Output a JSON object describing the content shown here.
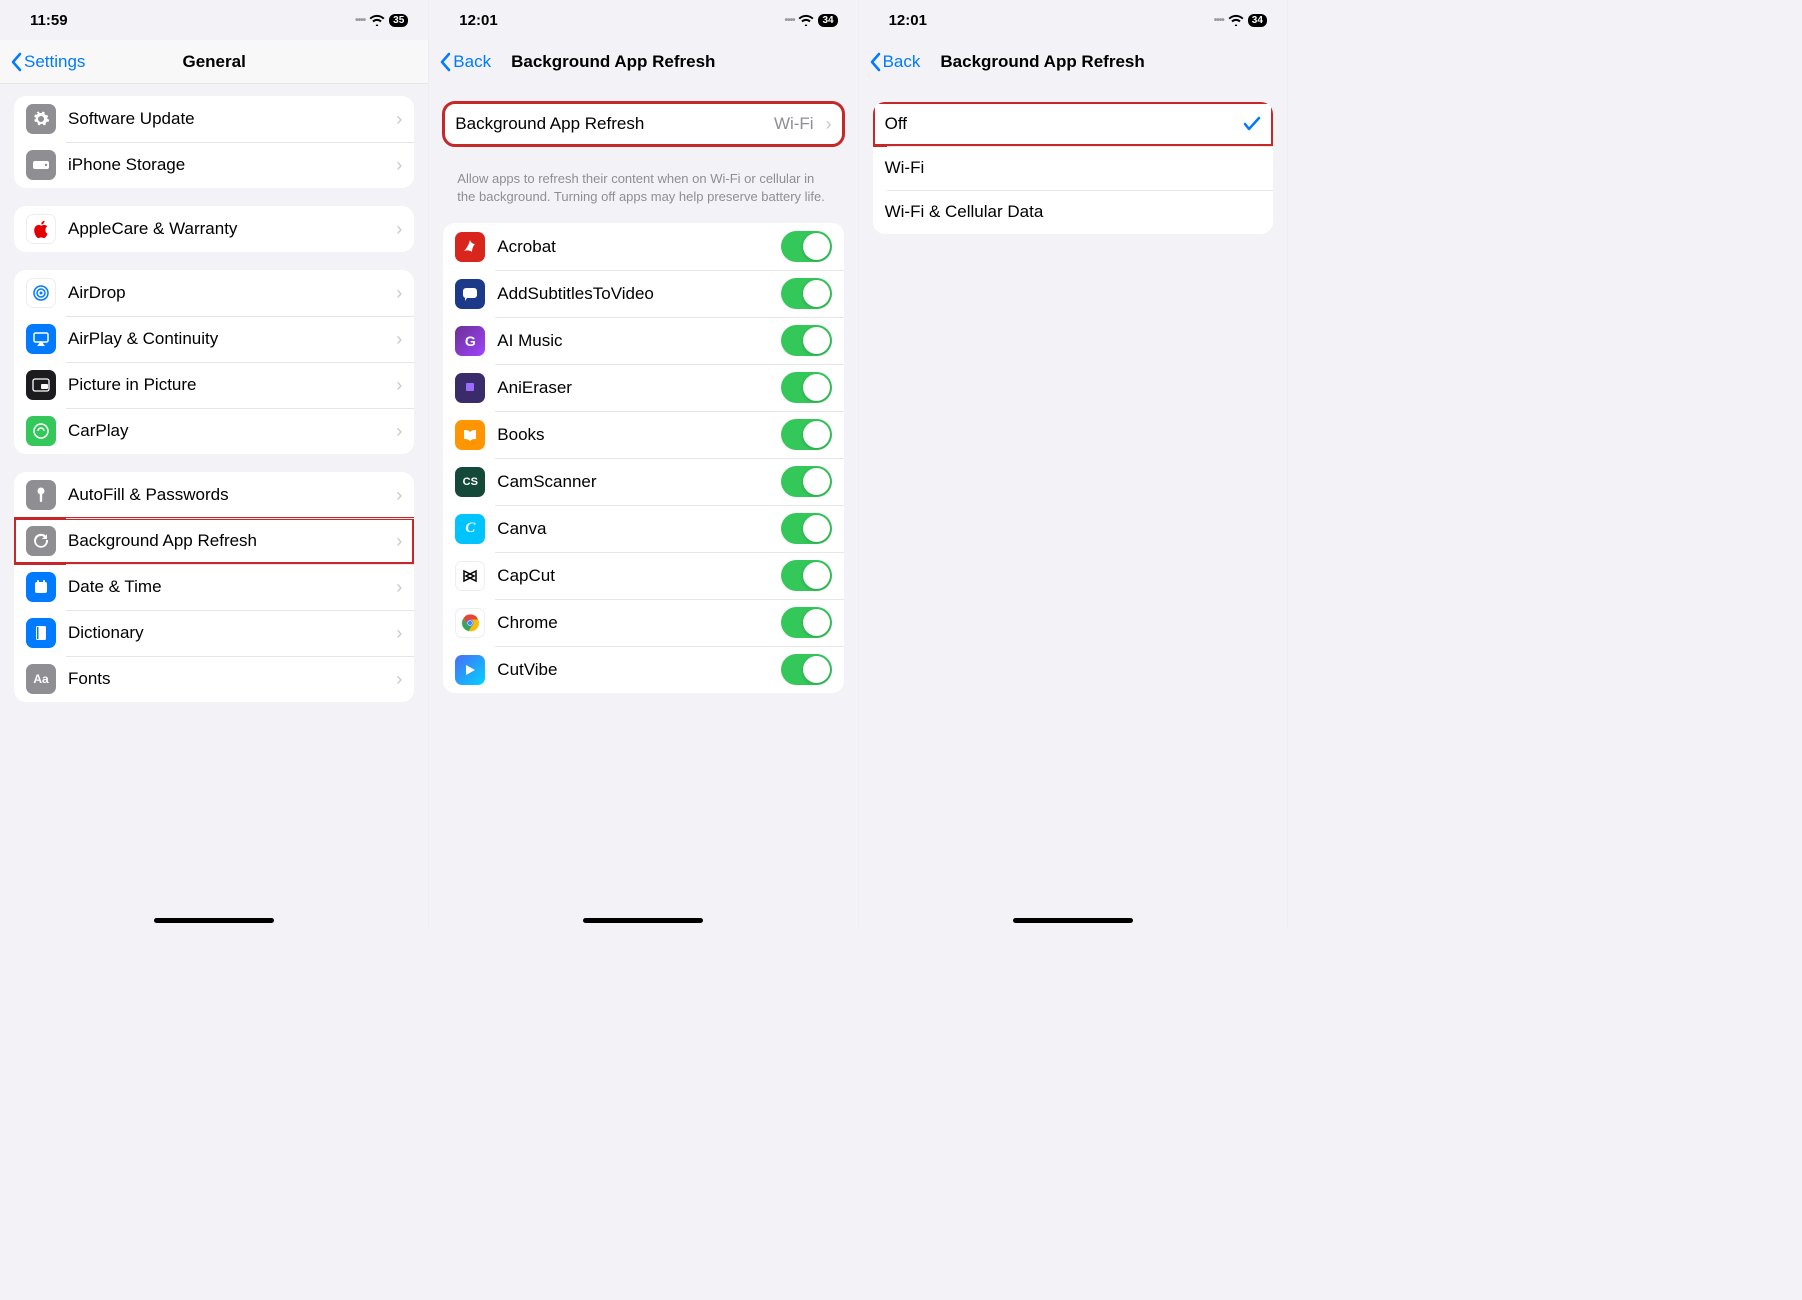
{
  "screen1": {
    "time": "11:59",
    "battery": "35",
    "back": "Settings",
    "title": "General",
    "groups": [
      {
        "rows": [
          {
            "icon": "gear-icon",
            "label": "Software Update"
          },
          {
            "icon": "storage-icon",
            "label": "iPhone Storage"
          }
        ]
      },
      {
        "rows": [
          {
            "icon": "apple-icon",
            "label": "AppleCare & Warranty"
          }
        ]
      },
      {
        "rows": [
          {
            "icon": "airdrop-icon",
            "label": "AirDrop"
          },
          {
            "icon": "airplay-icon",
            "label": "AirPlay & Continuity"
          },
          {
            "icon": "pip-icon",
            "label": "Picture in Picture"
          },
          {
            "icon": "carplay-icon",
            "label": "CarPlay"
          }
        ]
      },
      {
        "rows": [
          {
            "icon": "autofill-icon",
            "label": "AutoFill & Passwords"
          },
          {
            "icon": "refresh-icon",
            "label": "Background App Refresh",
            "highlight": true
          },
          {
            "icon": "datetime-icon",
            "label": "Date & Time"
          },
          {
            "icon": "dictionary-icon",
            "label": "Dictionary"
          },
          {
            "icon": "fonts-icon",
            "label": "Fonts"
          }
        ]
      }
    ]
  },
  "screen2": {
    "time": "12:01",
    "battery": "34",
    "back": "Back",
    "title": "Background App Refresh",
    "master": {
      "label": "Background App Refresh",
      "value": "Wi-Fi"
    },
    "footer": "Allow apps to refresh their content when on Wi-Fi or cellular in the background. Turning off apps may help preserve battery life.",
    "apps": [
      {
        "icon": "acrobat-icon",
        "label": "Acrobat",
        "on": true
      },
      {
        "icon": "subtitles-icon",
        "label": "AddSubtitlesToVideo",
        "on": true
      },
      {
        "icon": "aimusic-icon",
        "label": "AI Music",
        "on": true
      },
      {
        "icon": "anieraser-icon",
        "label": "AniEraser",
        "on": true
      },
      {
        "icon": "books-icon",
        "label": "Books",
        "on": true
      },
      {
        "icon": "camscanner-icon",
        "label": "CamScanner",
        "on": true
      },
      {
        "icon": "canva-icon",
        "label": "Canva",
        "on": true
      },
      {
        "icon": "capcut-icon",
        "label": "CapCut",
        "on": true
      },
      {
        "icon": "chrome-icon",
        "label": "Chrome",
        "on": true
      },
      {
        "icon": "cutvibe-icon",
        "label": "CutVibe",
        "on": true
      }
    ]
  },
  "screen3": {
    "time": "12:01",
    "battery": "34",
    "back": "Back",
    "title": "Background App Refresh",
    "options": [
      {
        "label": "Off",
        "selected": true,
        "highlight": true
      },
      {
        "label": "Wi-Fi",
        "selected": false
      },
      {
        "label": "Wi-Fi & Cellular Data",
        "selected": false
      }
    ]
  }
}
